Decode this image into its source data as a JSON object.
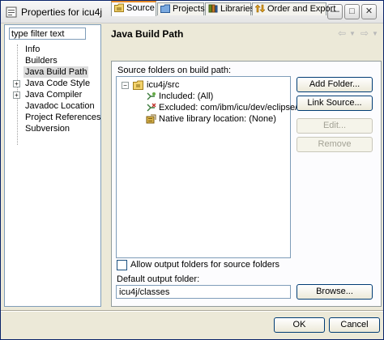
{
  "window": {
    "title": "Properties for icu4j"
  },
  "title_buttons": {
    "minimize": "—",
    "maximize": "□",
    "close": "✕"
  },
  "sidebar": {
    "filter": {
      "value": "type filter text"
    },
    "items": [
      {
        "label": "Info",
        "expandable": false,
        "selected": false
      },
      {
        "label": "Builders",
        "expandable": false,
        "selected": false
      },
      {
        "label": "Java Build Path",
        "expandable": false,
        "selected": true
      },
      {
        "label": "Java Code Style",
        "expandable": true,
        "selected": false
      },
      {
        "label": "Java Compiler",
        "expandable": true,
        "selected": false
      },
      {
        "label": "Javadoc Location",
        "expandable": false,
        "selected": false
      },
      {
        "label": "Project References",
        "expandable": false,
        "selected": false
      },
      {
        "label": "Subversion",
        "expandable": false,
        "selected": false
      }
    ]
  },
  "page": {
    "title": "Java Build Path",
    "nav": {
      "back": "⇦",
      "back_menu": "▼",
      "forward": "⇨",
      "forward_menu": "▼"
    }
  },
  "tabs": [
    {
      "label": "Source",
      "icon": "source-folder-icon",
      "active": true
    },
    {
      "label": "Projects",
      "icon": "projects-icon",
      "active": false
    },
    {
      "label": "Libraries",
      "icon": "libraries-icon",
      "active": false
    },
    {
      "label": "Order and Export",
      "icon": "order-export-icon",
      "active": false
    }
  ],
  "source": {
    "section_label": "Source folders on build path:",
    "tree": {
      "root": {
        "label": "icu4j/src",
        "expander": "⊟"
      },
      "children": [
        {
          "label": "Included: (All)",
          "icon": "included-filter-icon"
        },
        {
          "label": "Excluded: com/ibm/icu/dev/eclipse/**",
          "icon": "excluded-filter-icon"
        },
        {
          "label": "Native library location: (None)",
          "icon": "native-library-icon"
        }
      ]
    },
    "buttons": {
      "add_folder": "Add Folder...",
      "link_source": "Link Source...",
      "edit": "Edit...",
      "remove": "Remove"
    },
    "allow_output_checkbox": {
      "label": "Allow output folders for source folders",
      "checked": false
    },
    "default_output": {
      "label": "Default output folder:",
      "value": "icu4j/classes",
      "browse": "Browse..."
    }
  },
  "footer": {
    "ok": "OK",
    "cancel": "Cancel"
  },
  "colors": {
    "accent_tab": "#e68b2c",
    "selection": "#dcdcdc",
    "border": "#7f9db9"
  }
}
